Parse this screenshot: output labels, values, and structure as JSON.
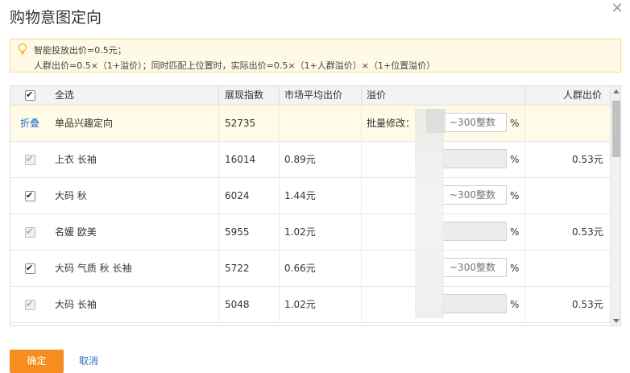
{
  "dialog": {
    "title": "购物意图定向",
    "close_icon": "close-x-icon"
  },
  "notice": {
    "icon": "lightbulb-icon",
    "line1": "智能投放出价=0.5元；",
    "line2": "人群出价=0.5×（1+溢价）；同时匹配上位置时，实际出价=0.5×（1+人群溢价）×（1+位置溢价）"
  },
  "table": {
    "headers": {
      "select_all": "全选",
      "impression_index": "展现指数",
      "market_avg_bid": "市场平均出价",
      "premium": "溢价",
      "crowd_bid": "人群出价"
    },
    "group_row": {
      "fold_label": "折叠",
      "name": "单品兴趣定向",
      "impression_index": "52735",
      "batch_label": "批量修改：",
      "placeholder": "~300整数",
      "unit": "%"
    },
    "rows": [
      {
        "name": "上衣 长袖",
        "impression_index": "16014",
        "market_avg_bid": "0.89元",
        "premium_placeholder": "",
        "unit": "%",
        "crowd_bid": "0.53元",
        "checked": true,
        "disabled": true
      },
      {
        "name": "大码 秋",
        "impression_index": "6024",
        "market_avg_bid": "1.44元",
        "premium_placeholder": "~300整数",
        "unit": "%",
        "crowd_bid": "",
        "checked": true,
        "disabled": false
      },
      {
        "name": "名媛 欧美",
        "impression_index": "5955",
        "market_avg_bid": "1.02元",
        "premium_placeholder": "",
        "unit": "%",
        "crowd_bid": "0.53元",
        "checked": true,
        "disabled": true
      },
      {
        "name": "大码 气质 秋 长袖",
        "impression_index": "5722",
        "market_avg_bid": "0.66元",
        "premium_placeholder": "~300整数",
        "unit": "%",
        "crowd_bid": "",
        "checked": true,
        "disabled": false
      },
      {
        "name": "大码 长袖",
        "impression_index": "5048",
        "market_avg_bid": "1.02元",
        "premium_placeholder": "",
        "unit": "%",
        "crowd_bid": "0.53元",
        "checked": true,
        "disabled": true
      }
    ]
  },
  "footer": {
    "confirm_label": "确定",
    "cancel_label": "取消"
  },
  "colors": {
    "accent_orange": "#f78c1f",
    "link_blue": "#2a6fc9",
    "notice_bg": "#fffae5",
    "group_row_bg": "#fffbe6"
  }
}
